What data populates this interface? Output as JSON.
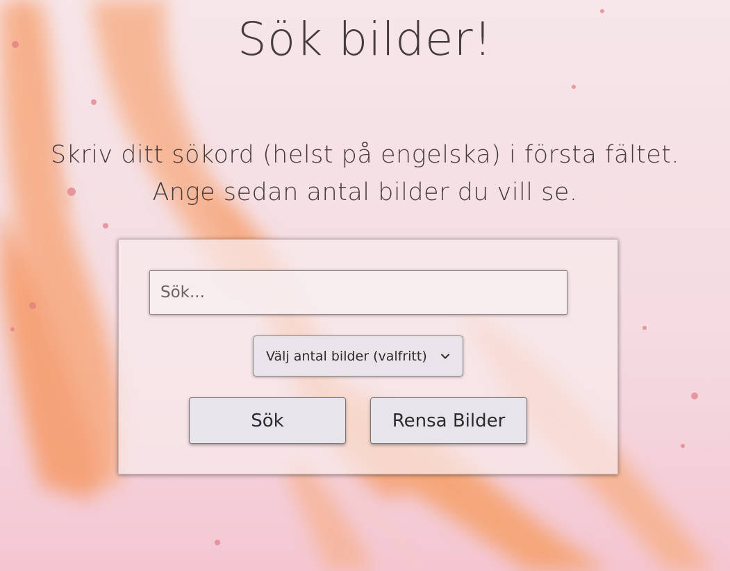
{
  "page": {
    "title": "Sök bilder!",
    "instructions": [
      "Skriv ditt sökord (helst på engelska) i första fältet.",
      "Ange sedan antal bilder du vill se."
    ]
  },
  "form": {
    "search": {
      "placeholder": "Sök...",
      "value": ""
    },
    "count_select": {
      "selected": "Välj antal bilder (valfritt)",
      "icon": "chevron-down-icon"
    },
    "search_button_label": "Sök",
    "clear_button_label": "Rensa Bilder"
  },
  "colors": {
    "background": "#f7e3e7",
    "accent_orange": "#f5a56a",
    "text": "#453a3d",
    "button_bg": "#e7e5eb"
  }
}
